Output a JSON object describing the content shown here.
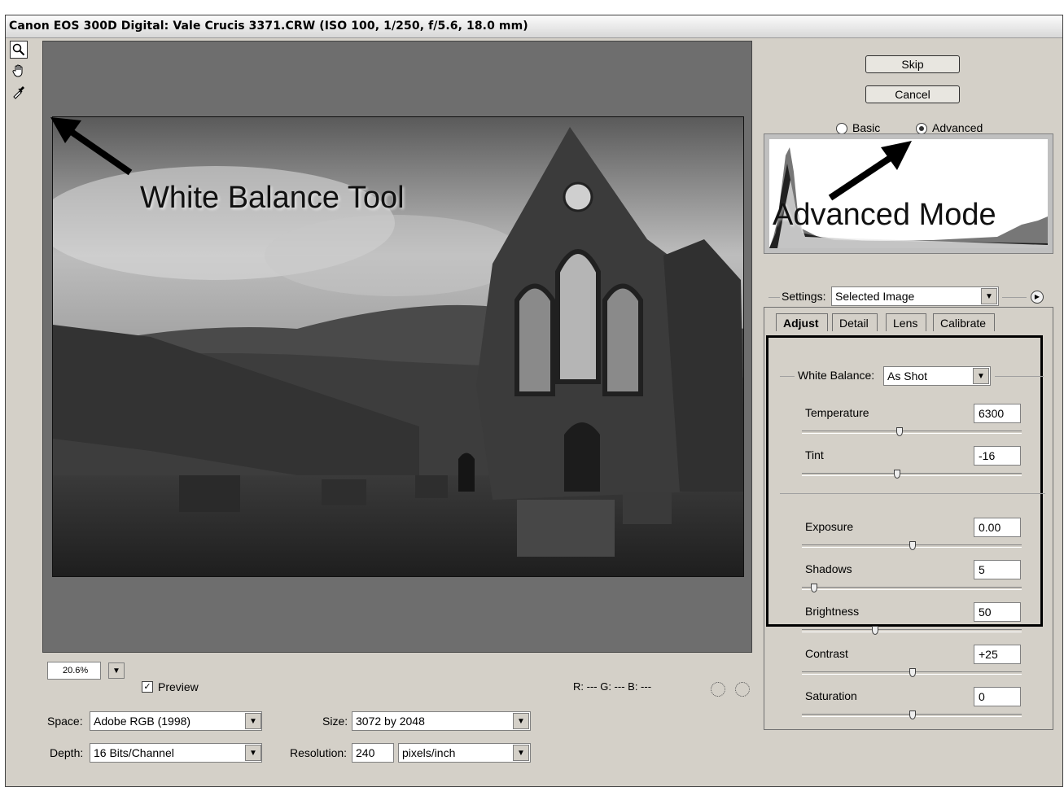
{
  "title": "Canon EOS 300D Digital:  Vale Crucis 3371.CRW  (ISO 100, 1/250, f/5.6, 18.0 mm)",
  "tools": [
    {
      "name": "zoom",
      "icon": "magnifier-icon"
    },
    {
      "name": "hand",
      "icon": "hand-icon"
    },
    {
      "name": "white-balance",
      "icon": "eyedropper-icon"
    }
  ],
  "annotations": {
    "white_balance_tool": "White Balance Tool",
    "advanced_mode": "Advanced Mode"
  },
  "buttons": {
    "skip": "Skip",
    "cancel": "Cancel"
  },
  "mode": {
    "basic": "Basic",
    "advanced": "Advanced",
    "selected": "advanced"
  },
  "settings": {
    "label": "Settings:",
    "value": "Selected Image"
  },
  "tabs": [
    "Adjust",
    "Detail",
    "Lens",
    "Calibrate"
  ],
  "white_balance": {
    "label": "White Balance:",
    "value": "As Shot"
  },
  "adjust": [
    {
      "label": "Temperature",
      "value": "6300",
      "level": 0.44
    },
    {
      "label": "Tint",
      "value": "-16",
      "level": 0.43
    },
    {
      "label": "Exposure",
      "value": "0.00",
      "level": 0.5
    },
    {
      "label": "Shadows",
      "value": "5",
      "level": 0.05
    },
    {
      "label": "Brightness",
      "value": "50",
      "level": 0.33
    },
    {
      "label": "Contrast",
      "value": "+25",
      "level": 0.5
    },
    {
      "label": "Saturation",
      "value": "0",
      "level": 0.5
    }
  ],
  "bottom": {
    "zoom": "20.6%",
    "preview": "Preview",
    "rgb": "R:  --- G:  --- B:  ---",
    "space_label": "Space:",
    "space_value": "Adobe RGB (1998)",
    "size_label": "Size:",
    "size_value": "3072 by 2048",
    "depth_label": "Depth:",
    "depth_value": "16 Bits/Channel",
    "resolution_label": "Resolution:",
    "resolution_value": "240",
    "resolution_unit": "pixels/inch"
  }
}
